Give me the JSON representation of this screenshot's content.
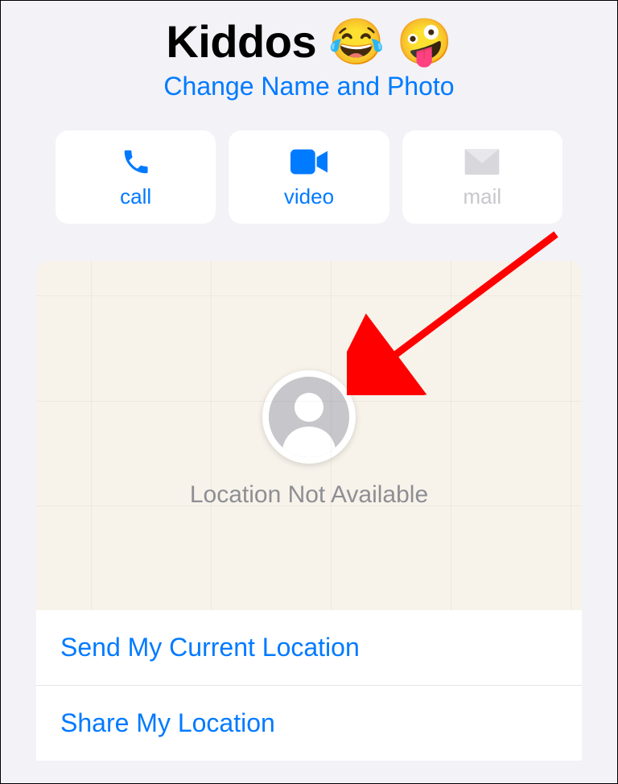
{
  "header": {
    "title": "Kiddos 😂 🤪",
    "change_link": "Change Name and Photo"
  },
  "actions": {
    "call": "call",
    "video": "video",
    "mail": "mail"
  },
  "map": {
    "not_available": "Location Not Available"
  },
  "options": {
    "send_current": "Send My Current Location",
    "share": "Share My Location"
  },
  "colors": {
    "tint": "#007aff",
    "disabled": "#c7c7cc"
  }
}
